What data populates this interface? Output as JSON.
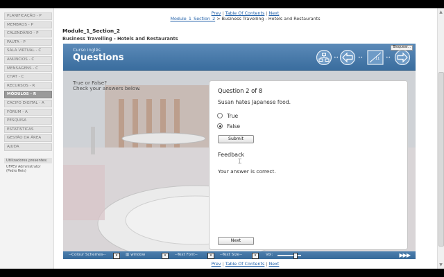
{
  "sidebar": {
    "items": [
      {
        "label": "PLANIFICAÇÃO - P"
      },
      {
        "label": "MEMBROS - P"
      },
      {
        "label": "CALENDÁRIO - P"
      },
      {
        "label": "PAUTA - P"
      },
      {
        "label": "SALA VIRTUAL - C"
      },
      {
        "label": "ANÚNCIOS - C"
      },
      {
        "label": "MENSAGENS - C"
      },
      {
        "label": "CHAT - C"
      },
      {
        "label": "RECURSOS - R"
      },
      {
        "label": "MÓDULOS - R"
      },
      {
        "label": "CACIFO DIGITAL - A"
      },
      {
        "label": "FÓRUM - A"
      },
      {
        "label": "PESQUISA"
      },
      {
        "label": "ESTATÍSTICAS"
      },
      {
        "label": "GESTÃO DA ÁREA"
      },
      {
        "label": "AJUDA"
      }
    ],
    "active_index": 9,
    "users_heading": "Utilizadores presentes:",
    "users_line1": "UFPEV Administrator",
    "users_line2": "(Pedro Reis)"
  },
  "nav": {
    "prev": "Prev",
    "toc": "Table Of Contents",
    "next": "Next",
    "separator": "|",
    "breadcrumb_link": "Module_1_Section_2",
    "breadcrumb_sep": ">",
    "breadcrumb_current": "Business Travelling - Hotels and Restaurants"
  },
  "module": {
    "title": "Module_1_Section_2",
    "subtitle": "Business Travelling - Hotels and Restaurants"
  },
  "course": {
    "header_small": "Curso inglês",
    "header_big": "Questions",
    "bloquear": "Bloquear...",
    "instructions": "True or False?\nCheck your answers below.",
    "question_title": "Question 2 of 8",
    "question_text": "Susan hates Japanese food.",
    "options": [
      {
        "label": "True",
        "checked": false
      },
      {
        "label": "False",
        "checked": true
      }
    ],
    "submit_label": "Submit",
    "feedback_title": "Feedback",
    "feedback_text": "Your answer is correct.",
    "next_label": "Next"
  },
  "footer": {
    "colour_schemes": "--Colour Schemes--",
    "window": "▥ window",
    "text_font": "--Text Font--",
    "text_size": "--Text Size--",
    "vol": "Vol:",
    "volume_level": 0.7,
    "dropdown_glyph": "▾",
    "play_glyph": "▶▶▶"
  },
  "colors": {
    "header_blue": "#3a6d9e",
    "link_blue": "#1f5fa8",
    "active_sidebar": "#9a9a9a"
  }
}
